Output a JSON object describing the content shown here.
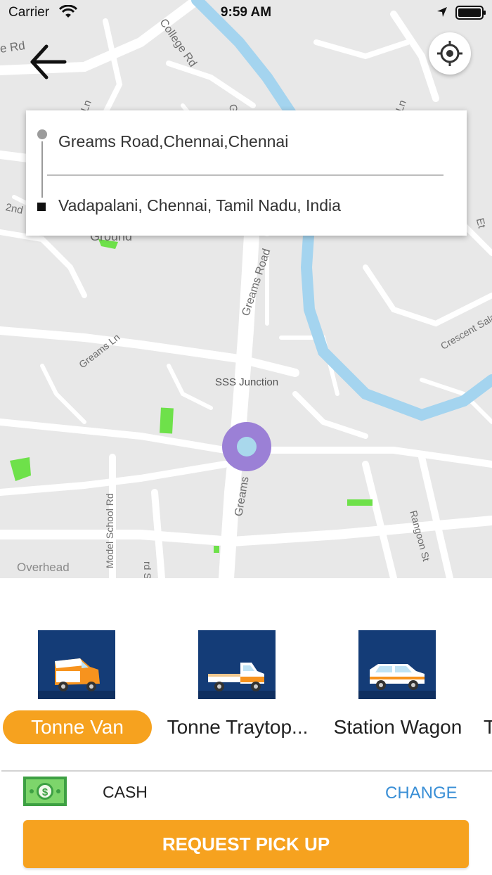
{
  "status_bar": {
    "carrier": "Carrier",
    "time": "9:59 AM",
    "icons": [
      "wifi-icon",
      "location-arrow-icon",
      "battery-icon"
    ]
  },
  "map": {
    "labels": {
      "college_rd": "College Rd",
      "e_rd": "e Rd",
      "gn_ln": "Ln",
      "g_top": "G",
      "ln_right": "Ln",
      "second": "2nd",
      "ground": "Ground",
      "greams_road": "Greams Road",
      "greams_ln": "Greams Ln",
      "crescent": "Crescent Salai",
      "sss_junction": "SSS Junction",
      "greams_lower": "Greams",
      "model_school": "Model School Rd",
      "rd_st": "rd St",
      "rangoon": "Rangoon St",
      "overhead": "Overhead",
      "et_right": "Et"
    },
    "colors": {
      "land": "#e8e8e8",
      "road": "#ffffff",
      "river": "#a4d4ef",
      "park": "#6ee14a",
      "pin": "#9b80d6"
    }
  },
  "route": {
    "pickup": "Greams Road,Chennai,Chennai",
    "dropoff": "Vadapalani, Chennai, Tamil Nadu, India"
  },
  "vehicles": [
    {
      "label": "Tonne Van",
      "selected": true,
      "icon": "van-icon"
    },
    {
      "label": "Tonne Traytop...",
      "selected": false,
      "icon": "traytop-truck-icon"
    },
    {
      "label": "Station Wagon",
      "selected": false,
      "icon": "station-wagon-icon"
    },
    {
      "label": "T",
      "selected": false,
      "icon": ""
    }
  ],
  "payment": {
    "method": "CASH",
    "change_label": "CHANGE",
    "icon": "cash-icon"
  },
  "request_button": "REQUEST PICK UP",
  "accent_color": "#f6a21f"
}
